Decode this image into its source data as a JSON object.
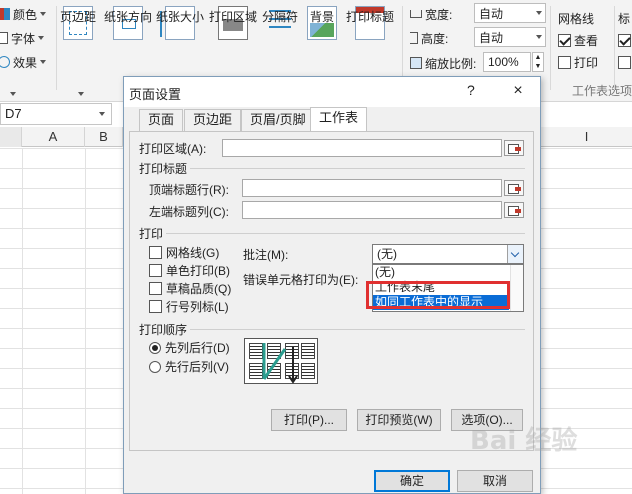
{
  "ribbon": {
    "font_group": {
      "color_label": "颜色",
      "font_label": "字体",
      "effect_label": "效果"
    },
    "page_setup_buttons": [
      "页边距",
      "纸张方向",
      "纸张大小",
      "打印区域",
      "分隔符",
      "背景",
      "打印标题"
    ],
    "scale": {
      "width_label": "宽度:",
      "width_value": "自动",
      "height_label": "高度:",
      "height_value": "自动",
      "zoom_label": "缩放比例:",
      "zoom_value": "100%"
    },
    "sheet_options": {
      "gridlines_label": "网格线",
      "view_label": "查看",
      "print_label": "打印",
      "group_label": "工作表选项",
      "headings_label_partial": "标"
    }
  },
  "namebox": {
    "value": "D7"
  },
  "columns": [
    "A",
    "B",
    "I"
  ],
  "dialog": {
    "title": "页面设置",
    "help": "?",
    "close": "×",
    "tabs": [
      "页面",
      "页边距",
      "页眉/页脚",
      "工作表"
    ],
    "active_tab": "工作表",
    "print_area_label": "打印区域(A):",
    "print_titles_group": "打印标题",
    "top_rows_label": "顶端标题行(R):",
    "left_cols_label": "左端标题列(C):",
    "print_group": "打印",
    "checkboxes": [
      {
        "label": "网格线(G)",
        "checked": false
      },
      {
        "label": "单色打印(B)",
        "checked": false
      },
      {
        "label": "草稿品质(Q)",
        "checked": false
      },
      {
        "label": "行号列标(L)",
        "checked": false
      }
    ],
    "comments_label": "批注(M):",
    "comments_value": "(无)",
    "errors_label": "错误单元格打印为(E):",
    "dropdown_options": [
      "(无)",
      "工作表末尾",
      "如同工作表中的显示"
    ],
    "dropdown_selected": "如同工作表中的显示",
    "order_group": "打印顺序",
    "order_options": [
      {
        "label": "先列后行(D)",
        "selected": true
      },
      {
        "label": "先行后列(V)",
        "selected": false
      }
    ],
    "buttons": {
      "print": "打印(P)...",
      "preview": "打印预览(W)",
      "options": "选项(O)...",
      "ok": "确定",
      "cancel": "取消"
    }
  },
  "watermark": "Bai 经验"
}
